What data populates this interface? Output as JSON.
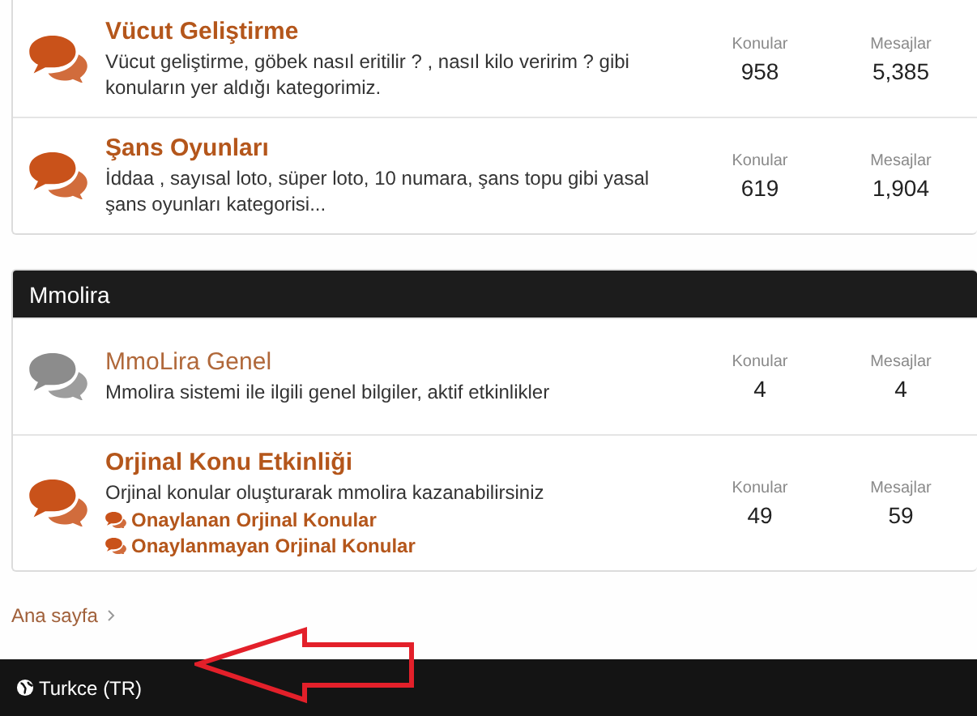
{
  "categories": [
    {
      "forums": [
        {
          "title": "Vücut Geliştirme",
          "unread": true,
          "description": "Vücut geliştirme, göbek nasıl eritilir ? , nasıl kilo veririm ? gibi konuların yer aldığı kategorimiz.",
          "stats": [
            {
              "label": "Konular",
              "value": "958"
            },
            {
              "label": "Mesajlar",
              "value": "5,385"
            }
          ]
        },
        {
          "title": "Şans Oyunları",
          "unread": true,
          "description": "İddaa , sayısal loto, süper loto, 10 numara, şans topu gibi yasal şans oyunları kategorisi...",
          "stats": [
            {
              "label": "Konular",
              "value": "619"
            },
            {
              "label": "Mesajlar",
              "value": "1,904"
            }
          ]
        }
      ]
    },
    {
      "title": "Mmolira",
      "forums": [
        {
          "title": "MmoLira Genel",
          "unread": false,
          "description": "Mmolira sistemi ile ilgili genel bilgiler, aktif etkinlikler",
          "stats": [
            {
              "label": "Konular",
              "value": "4"
            },
            {
              "label": "Mesajlar",
              "value": "4"
            }
          ]
        },
        {
          "title": "Orjinal Konu Etkinliği",
          "unread": true,
          "description": "Orjinal konular oluşturarak mmolira kazanabilirsiniz",
          "subforums": [
            "Onaylanan Orjinal Konular",
            "Onaylanmayan Orjinal Konular"
          ],
          "stats": [
            {
              "label": "Konular",
              "value": "49"
            },
            {
              "label": "Mesajlar",
              "value": "59"
            }
          ]
        }
      ]
    }
  ],
  "breadcrumb": [
    "Ana sayfa"
  ],
  "footer": {
    "language": "Turkce (TR)"
  }
}
